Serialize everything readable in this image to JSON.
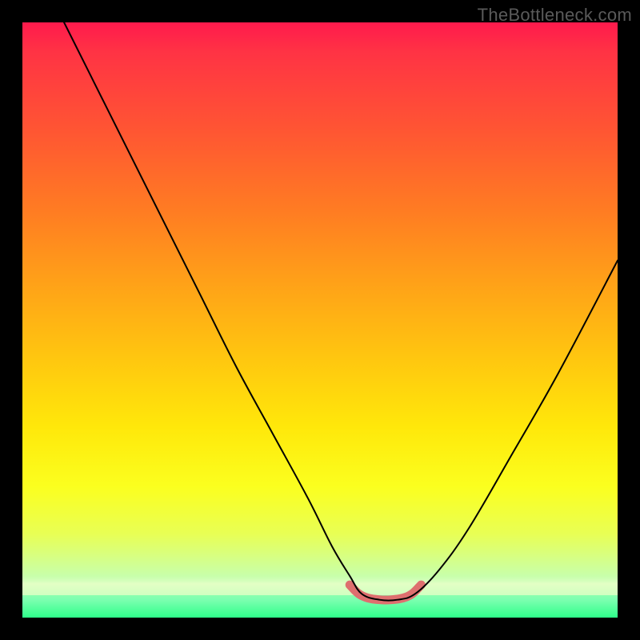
{
  "watermark": "TheBottleneck.com",
  "chart_data": {
    "type": "line",
    "title": "",
    "xlabel": "",
    "ylabel": "",
    "xlim": [
      0,
      100
    ],
    "ylim": [
      0,
      100
    ],
    "grid": false,
    "legend": false,
    "series": [
      {
        "name": "bottleneck-curve",
        "x_pct": [
          7,
          12,
          18,
          24,
          30,
          36,
          42,
          48,
          52,
          55,
          57,
          60,
          63,
          66,
          70,
          75,
          82,
          90,
          100
        ],
        "y_pct": [
          100,
          90,
          78,
          66,
          54,
          42,
          31,
          20,
          12,
          7,
          4,
          3,
          3,
          4,
          8,
          15,
          27,
          41,
          60
        ],
        "color": "#000000",
        "stroke_width": 2
      },
      {
        "name": "optimal-range-highlight",
        "x_pct": [
          55,
          56.5,
          58,
          60,
          62,
          64,
          65.5,
          67
        ],
        "y_pct": [
          5.5,
          4,
          3.3,
          3,
          3,
          3.3,
          4,
          5.5
        ],
        "color": "#de6f6f",
        "stroke_width": 11
      }
    ],
    "background_gradient": {
      "top": "#ff1a4d",
      "mid": "#ffe80a",
      "bottom": "#2eff8a"
    },
    "annotations": []
  }
}
